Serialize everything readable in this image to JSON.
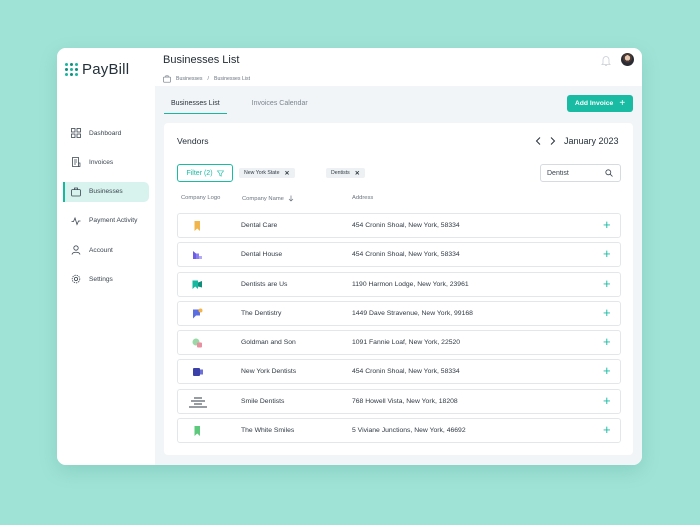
{
  "app": {
    "name": "PayBill"
  },
  "sidebar": {
    "items": [
      {
        "label": "Dashboard",
        "icon": "dashboard-icon",
        "active": false
      },
      {
        "label": "Invoices",
        "icon": "invoice-icon",
        "active": false
      },
      {
        "label": "Businesses",
        "icon": "briefcase-icon",
        "active": true
      },
      {
        "label": "Payment Activity",
        "icon": "activity-icon",
        "active": false
      },
      {
        "label": "Account",
        "icon": "user-icon",
        "active": false
      },
      {
        "label": "Settings",
        "icon": "gear-icon",
        "active": false
      }
    ]
  },
  "header": {
    "title": "Businesses List",
    "breadcrumb": [
      "Businesses",
      "Businesses List"
    ],
    "breadcrumb_separator": "/"
  },
  "tabs": [
    {
      "label": "Businesses List",
      "active": true
    },
    {
      "label": "Invoices Calendar",
      "active": false
    }
  ],
  "actions": {
    "add_invoice_label": "Add Invoice",
    "add_invoice_plus": "+"
  },
  "panel": {
    "title": "Vendors",
    "month": "January 2023",
    "filter_label": "Filter (2)",
    "chips": [
      {
        "label": "New York State",
        "remove": "✕"
      },
      {
        "label": "Dentists",
        "remove": "✕"
      }
    ],
    "search": {
      "value": "Dentist",
      "placeholder": "Search"
    },
    "columns": [
      "Company Logo",
      "Company Name",
      "Address"
    ]
  },
  "vendors": [
    {
      "name": "Dental Care",
      "address": "454 Cronin Shoal, New York, 58334",
      "logo": "bookmark-logo"
    },
    {
      "name": "Dental House",
      "address": "454 Cronin Shoal, New York, 58334",
      "logo": "blocks-logo"
    },
    {
      "name": "Dentists are Us",
      "address": "1190 Harmon Lodge, New York, 23961",
      "logo": "flag-logo"
    },
    {
      "name": "The Dentistry",
      "address": "1449 Dave Stravenue, New York, 99168",
      "logo": "chat-logo"
    },
    {
      "name": "Goldman and Son",
      "address": "1091 Fannie Loaf, New York, 22520",
      "logo": "circles-logo"
    },
    {
      "name": "New York Dentists",
      "address": "454 Cronin Shoal, New York, 58334",
      "logo": "cube-logo"
    },
    {
      "name": "Smile Dentists",
      "address": "768 Howell Vista, New York, 18208",
      "logo": "lines-logo"
    },
    {
      "name": "The White Smiles",
      "address": "5 Viviane Junctions, New York, 46692",
      "logo": "bookmark-green-logo"
    }
  ],
  "row_action": "+",
  "colors": {
    "accent": "#19bba3",
    "background": "#9fe3d6",
    "active_nav": "#d8f3ee"
  }
}
